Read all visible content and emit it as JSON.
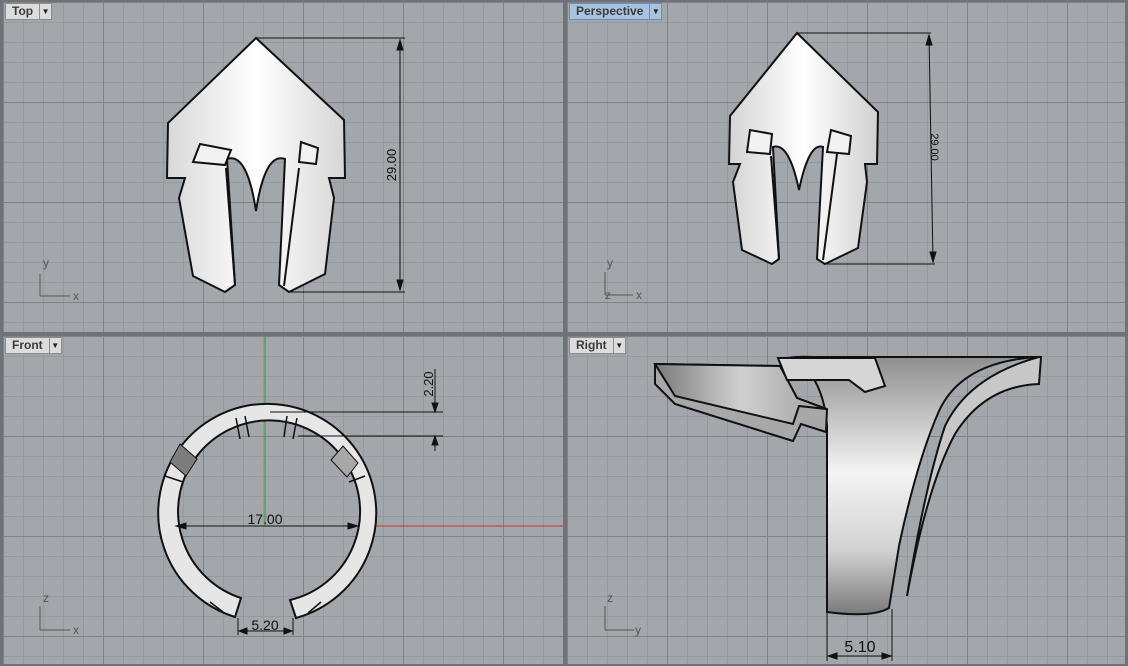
{
  "viewports": {
    "top": {
      "label": "Top",
      "dimension": "29.00",
      "axis_v": "y",
      "axis_h": "x"
    },
    "persp": {
      "label": "Perspective",
      "dimension": "29.00",
      "axis_v": "y",
      "axis_h": "x",
      "axis_z": "z"
    },
    "front": {
      "label": "Front",
      "dim_inner": "17.00",
      "dim_gap": "5.20",
      "dim_thickness": "2.20",
      "axis_v": "z",
      "axis_h": "x"
    },
    "right": {
      "label": "Right",
      "dimension": "5.10",
      "axis_v": "z",
      "axis_h": "y"
    }
  },
  "icons": {
    "dropdown": "chevron-down-icon"
  },
  "colors": {
    "active_tab": "#a7c3e0",
    "x_axis": "#c0392b",
    "y_axis": "#2e9e2e"
  }
}
